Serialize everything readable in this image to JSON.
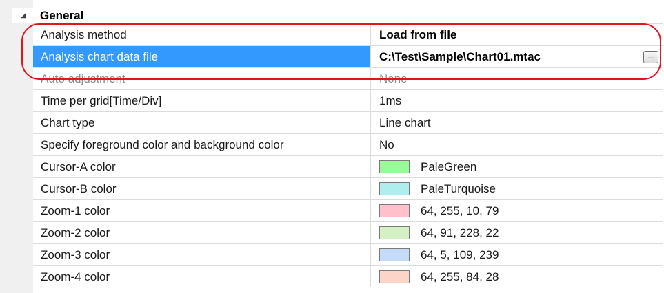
{
  "category": {
    "label": "General",
    "expander": "collapse-triangle-icon"
  },
  "properties": [
    {
      "name": "Analysis method",
      "value": "Load from file",
      "style": "bold"
    },
    {
      "name": "Analysis chart data file",
      "value": "C:\\Test\\Sample\\Chart01.mtac",
      "style": "bold",
      "selected": true,
      "button": "..."
    },
    {
      "name": "Auto adjustment",
      "value": "None",
      "disabled": true
    },
    {
      "name": "Time per grid[Time/Div]",
      "value": "1ms"
    },
    {
      "name": "Chart type",
      "value": "Line chart"
    },
    {
      "name": "Specify foreground color and background color",
      "value": "No"
    },
    {
      "name": "Cursor-A color",
      "value": "PaleGreen",
      "swatch": "#98fb98"
    },
    {
      "name": "Cursor-B color",
      "value": "PaleTurquoise",
      "swatch": "#afeeee"
    },
    {
      "name": "Zoom-1 color",
      "value": "64, 255, 10, 79",
      "swatch": "#ffc0cb"
    },
    {
      "name": "Zoom-2 color",
      "value": "64, 91, 228, 22",
      "swatch": "#d4f0c4"
    },
    {
      "name": "Zoom-3 color",
      "value": "64, 5, 109, 239",
      "swatch": "#c4dcf8"
    },
    {
      "name": "Zoom-4 color",
      "value": "64, 255, 84, 28",
      "swatch": "#fcd4c8"
    }
  ],
  "colors": {
    "selection": "#3399ff",
    "highlight_ring": "#e0161d"
  }
}
